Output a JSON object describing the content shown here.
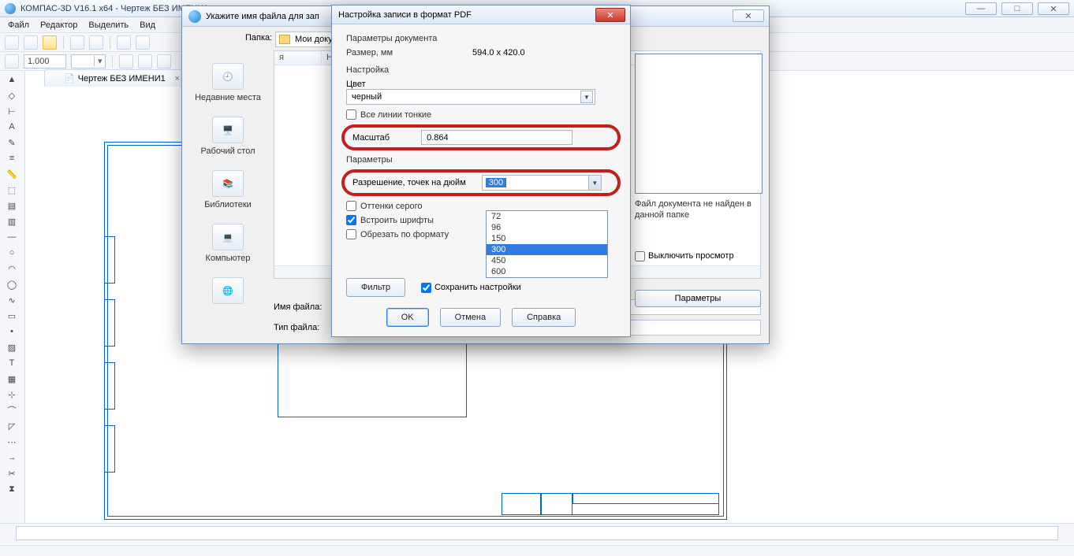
{
  "titlebar": {
    "title": "КОМПАС-3D V16.1 x64 - Чертеж БЕЗ ИМЕНИ1"
  },
  "win_controls": {
    "min": "—",
    "max": "□",
    "close": "✕"
  },
  "menubar": {
    "file": "Файл",
    "editor": "Редактор",
    "select": "Выделить",
    "view": "Вид"
  },
  "toolbar": {
    "zoom_value": "1.000"
  },
  "doc_tab": {
    "label": "Чертеж БЕЗ ИМЕНИ1",
    "close": "×"
  },
  "save_dialog": {
    "title": "Укажите имя файла для зап",
    "folder_label": "Папка:",
    "folder_value": "Мои доку",
    "list_headers": {
      "c1": "я",
      "c2": "Не"
    },
    "places": {
      "recent": "Недавние места",
      "desktop": "Рабочий стол",
      "libraries": "Библиотеки",
      "computer": "Компьютер"
    },
    "filename_label": "Имя файла:",
    "filetype_label": "Тип файла:",
    "close_glyph": "✕"
  },
  "preview": {
    "not_found": "Файл документа не найден в данной папке",
    "toggle": "Выключить просмотр",
    "params_btn": "Параметры"
  },
  "pdf_dialog": {
    "title": "Настройка записи в формат PDF",
    "close": "✕",
    "section_doc_params": "Параметры документа",
    "size_label": "Размер, мм",
    "size_value": "594.0 x 420.0",
    "section_settings": "Настройка",
    "color_label": "Цвет",
    "color_value": "черный",
    "thin_lines": "Все линии тонкие",
    "scale_label": "Масштаб",
    "scale_value": "0.864",
    "section_params": "Параметры",
    "resolution_label": "Разрешение, точек на дюйм",
    "resolution_value": "300",
    "grayscale": "Оттенки серого",
    "embed_fonts": "Встроить шрифты",
    "crop_format": "Обрезать по формату",
    "filter_btn": "Фильтр",
    "save_settings": "Сохранить настройки",
    "ok": "OK",
    "cancel": "Отмена",
    "help": "Справка",
    "options": [
      "72",
      "96",
      "150",
      "300",
      "450",
      "600"
    ]
  }
}
